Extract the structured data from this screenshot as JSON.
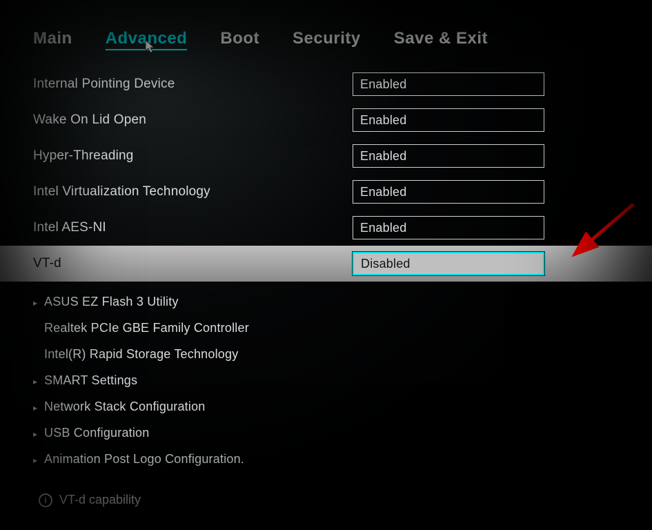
{
  "tabs": {
    "main": "Main",
    "advanced": "Advanced",
    "boot": "Boot",
    "security": "Security",
    "saveexit": "Save & Exit"
  },
  "settings": {
    "internal_pointing": {
      "label": "Internal Pointing Device",
      "value": "Enabled"
    },
    "wake_on_lid": {
      "label": "Wake On Lid Open",
      "value": "Enabled"
    },
    "hyper_threading": {
      "label": "Hyper-Threading",
      "value": "Enabled"
    },
    "intel_vt": {
      "label": "Intel Virtualization Technology",
      "value": "Enabled"
    },
    "aes_ni": {
      "label": "Intel AES-NI",
      "value": "Enabled"
    },
    "vt_d": {
      "label": "VT-d",
      "value": "Disabled"
    }
  },
  "submenus": {
    "ez_flash": "ASUS EZ Flash 3 Utility",
    "realtek": "Realtek PCIe GBE Family Controller",
    "rst": "Intel(R) Rapid Storage Technology",
    "smart": "SMART Settings",
    "netstack": "Network Stack Configuration",
    "usb": "USB Configuration",
    "anim": "Animation Post Logo Configuration."
  },
  "help": {
    "text": "VT-d capability"
  }
}
